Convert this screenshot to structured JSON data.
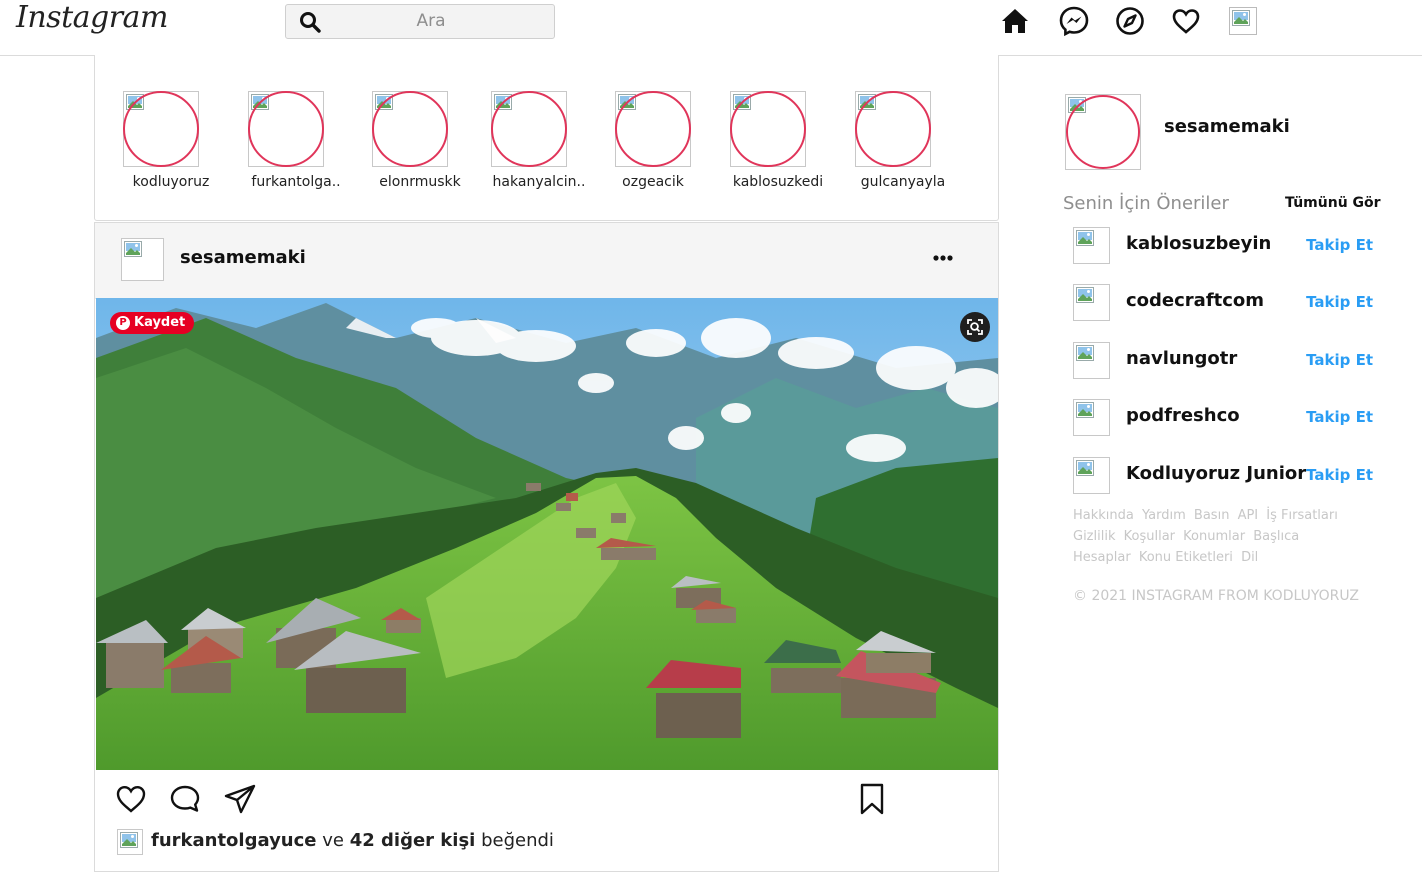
{
  "nav": {
    "logo": "Instagram",
    "search_placeholder": "Ara",
    "icons": [
      "home-icon",
      "messenger-icon",
      "explore-icon",
      "heart-icon",
      "profile-avatar"
    ]
  },
  "stories": [
    {
      "name": "kodluyoruz"
    },
    {
      "name": "furkantolga.."
    },
    {
      "name": "elonrmuskk"
    },
    {
      "name": "hakanyalcin.."
    },
    {
      "name": "ozgeacik"
    },
    {
      "name": "kablosuzkedi"
    },
    {
      "name": "gulcanyayla"
    }
  ],
  "post": {
    "username": "sesamemaki",
    "save_button": "Kaydet",
    "liked_by": {
      "user": "furkantolgayuce",
      "connector": "ve",
      "others": "42 diğer kişi",
      "suffix": "beğendi"
    }
  },
  "sidebar": {
    "username": "sesamemaki",
    "suggestions_title": "Senin İçin Öneriler",
    "see_all": "Tümünü Gör",
    "suggestions": [
      {
        "name": "kablosuzbeyin",
        "action": "Takip Et"
      },
      {
        "name": "codecraftcom",
        "action": "Takip Et"
      },
      {
        "name": "navlungotr",
        "action": "Takip Et"
      },
      {
        "name": "podfreshco",
        "action": "Takip Et"
      },
      {
        "name": "Kodluyoruz Junior",
        "action": "Takip Et"
      }
    ],
    "footer_links": [
      "Hakkında",
      "Yardım",
      "Basın",
      "API",
      "İş Fırsatları",
      "Gizlilik",
      "Koşullar",
      "Konumlar",
      "Başlıca Hesaplar",
      "Konu Etiketleri",
      "Dil"
    ],
    "copyright": "© 2021 INSTAGRAM FROM KODLUYORUZ"
  },
  "colors": {
    "story_ring": "#e0355a",
    "follow_link": "#2a9df4",
    "save_button": "#e60023",
    "muted_text": "#8e8e8e"
  }
}
